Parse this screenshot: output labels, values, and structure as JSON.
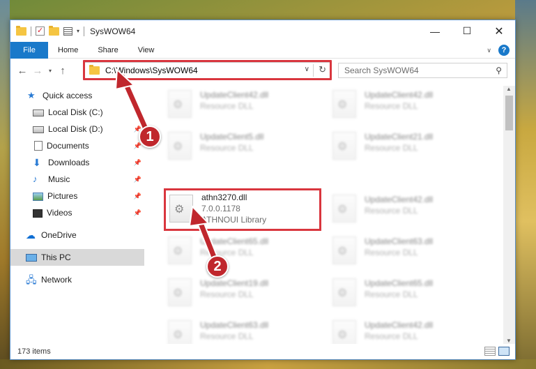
{
  "window": {
    "title": "SysWOW64"
  },
  "ribbon": {
    "tabs": [
      "File",
      "Home",
      "Share",
      "View"
    ],
    "help": "?"
  },
  "address": {
    "path": "C:\\Windows\\SysWOW64"
  },
  "search": {
    "placeholder": "Search SysWOW64"
  },
  "sidebar": {
    "items": [
      {
        "label": "Quick access",
        "icon": "star-icon"
      },
      {
        "label": "Local Disk (C:)",
        "icon": "drive-icon"
      },
      {
        "label": "Local Disk (D:)",
        "icon": "drive-icon"
      },
      {
        "label": "Documents",
        "icon": "document-icon"
      },
      {
        "label": "Downloads",
        "icon": "download-icon"
      },
      {
        "label": "Music",
        "icon": "music-icon"
      },
      {
        "label": "Pictures",
        "icon": "pictures-icon"
      },
      {
        "label": "Videos",
        "icon": "videos-icon"
      },
      {
        "label": "OneDrive",
        "icon": "cloud-icon"
      },
      {
        "label": "This PC",
        "icon": "computer-icon"
      },
      {
        "label": "Network",
        "icon": "network-icon"
      }
    ]
  },
  "files": [
    {
      "name": "UpdateClient42.dll",
      "desc": "Resource DLL"
    },
    {
      "name": "UpdateClient42.dll",
      "desc": "Resource DLL"
    },
    {
      "name": "UpdateClient5.dll",
      "desc": "Resource DLL"
    },
    {
      "name": "UpdateClient21.dll",
      "desc": "Resource DLL"
    },
    {
      "name": "athn3270.dll",
      "version": "7.0.0.1178",
      "desc": "ATHNOUI Library"
    },
    {
      "name": "UpdateClient42.dll",
      "desc": "Resource DLL"
    },
    {
      "name": "UpdateClient65.dll",
      "desc": "Resource DLL"
    },
    {
      "name": "UpdateClient63.dll",
      "desc": "Resource DLL"
    },
    {
      "name": "UpdateClient19.dll",
      "desc": "Resource DLL"
    },
    {
      "name": "UpdateClient65.dll",
      "desc": "Resource DLL"
    },
    {
      "name": "UpdateClient63.dll",
      "desc": "Resource DLL"
    },
    {
      "name": "UpdateClient42.dll",
      "desc": "Resource DLL"
    }
  ],
  "status": {
    "items_count": "173 items"
  },
  "annotations": {
    "badge1": "1",
    "badge2": "2"
  },
  "colors": {
    "accent": "#1979ca",
    "highlight": "#d9363e",
    "badge": "#c0272d"
  }
}
